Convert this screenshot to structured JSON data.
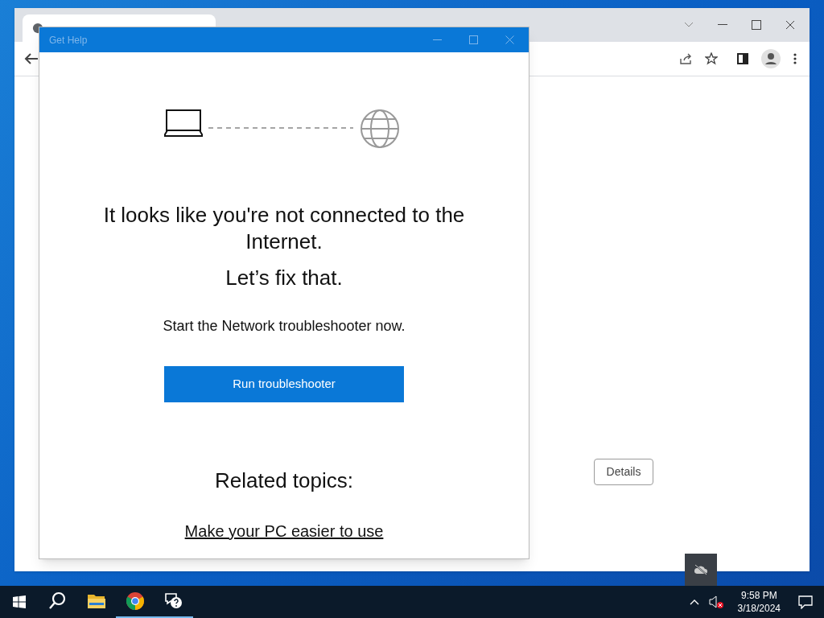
{
  "browser": {
    "details_button": "Details"
  },
  "get_help": {
    "title": "Get Help",
    "heading": "It looks like you're not connected to the Internet.",
    "subheading": "Let’s fix that.",
    "prompt": "Start the Network troubleshooter now.",
    "button": "Run troubleshooter",
    "related_title": "Related topics:",
    "related_links": [
      "Make your PC easier to use"
    ]
  },
  "taskbar": {
    "apps": [
      {
        "kind": "search",
        "running": false
      },
      {
        "kind": "folder",
        "running": false
      },
      {
        "kind": "chrome",
        "running": true
      },
      {
        "kind": "help",
        "running": true
      }
    ],
    "time": "9:58 PM",
    "date": "3/18/2024"
  }
}
